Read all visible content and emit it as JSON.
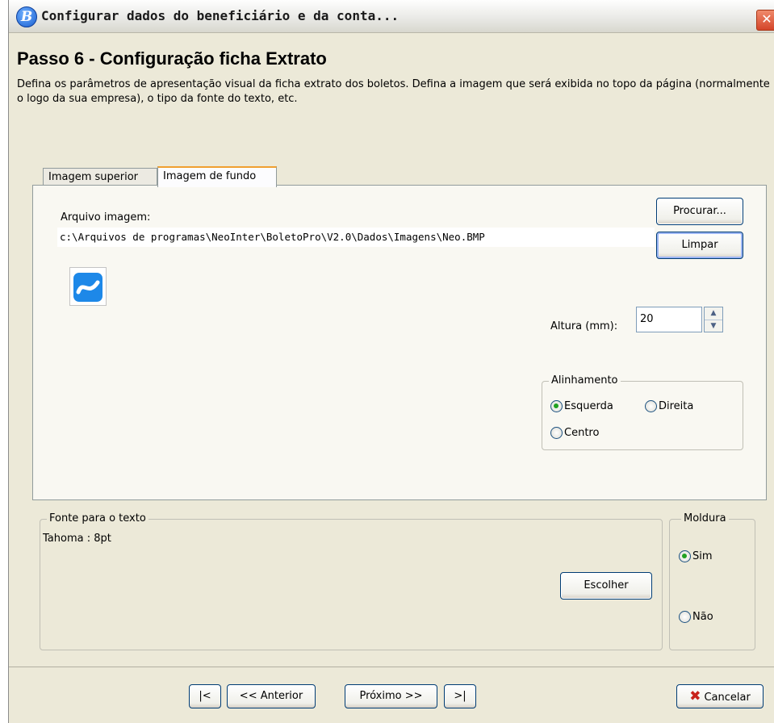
{
  "window": {
    "title": "Configurar dados do beneficiário e da conta...",
    "app_icon": "boletopro-icon",
    "close_label": "✕"
  },
  "header": {
    "step_title": "Passo 6 - Configuração ficha Extrato",
    "description": "Defina os parâmetros de apresentação visual da ficha extrato dos boletos. Defina a imagem que será exibida no topo da página (normalmente o logo da sua empresa), o tipo da fonte do texto, etc."
  },
  "tabs": [
    {
      "label": "Imagem superior",
      "active": false
    },
    {
      "label": "Imagem de fundo",
      "active": true
    }
  ],
  "image_panel": {
    "file_label": "Arquivo imagem:",
    "file_path": "c:\\Arquivos de programas\\NeoInter\\BoletoPro\\V2.0\\Dados\\Imagens\\Neo.BMP",
    "browse_button": "Procurar...",
    "clear_button": "Limpar",
    "height_label": "Altura (mm):",
    "height_value": "20",
    "alignment": {
      "legend": "Alinhamento",
      "options": [
        {
          "label": "Esquerda",
          "checked": true
        },
        {
          "label": "Direita",
          "checked": false
        },
        {
          "label": "Centro",
          "checked": false
        }
      ]
    }
  },
  "font_group": {
    "legend": "Fonte para o texto",
    "value": "Tahoma : 8pt",
    "choose_button": "Escolher"
  },
  "frame_group": {
    "legend": "Moldura",
    "options": [
      {
        "label": "Sim",
        "checked": true
      },
      {
        "label": "Não",
        "checked": false
      }
    ]
  },
  "navigation": {
    "first": "|<",
    "previous": "<< Anterior",
    "next": "Próximo >>",
    "last": ">|",
    "cancel": "Cancelar"
  },
  "colors": {
    "dialog_background": "#ece9d8",
    "active_tab_accent": "#f0a030",
    "cancel_icon": "#c8231b",
    "logo_blue": "#1d88e8"
  }
}
